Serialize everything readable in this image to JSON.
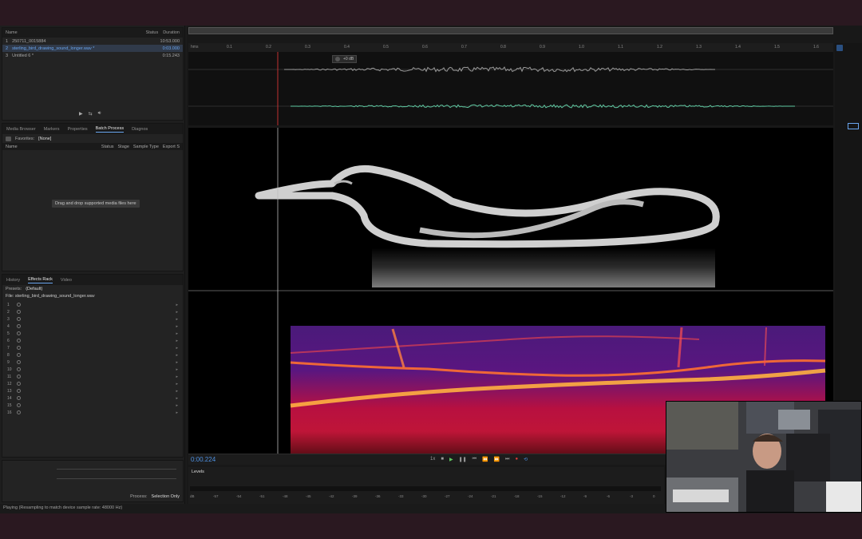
{
  "files_panel": {
    "columns": {
      "name": "Name",
      "status": "Status",
      "duration": "Duration"
    },
    "files": [
      {
        "num": "1",
        "name": "250711_0015884",
        "duration": "10:53.000"
      },
      {
        "num": "2",
        "name": "sterling_bird_drawing_sound_longer.wav *",
        "duration": "0:03.000"
      },
      {
        "num": "3",
        "name": "Untitled 6 *",
        "duration": "0:15.243"
      }
    ]
  },
  "batch_panel": {
    "tabs": [
      "Media Browser",
      "Markers",
      "Properties",
      "Batch Process",
      "Diagnos"
    ],
    "favorites_label": "Favorites:",
    "favorites_value": "[None]",
    "columns": [
      "Name",
      "Status",
      "Stage",
      "Sample Type",
      "Export S"
    ],
    "drop_hint": "Drag and drop supported media files here"
  },
  "effects_panel": {
    "tabs": [
      "History",
      "Effects Rack",
      "Video"
    ],
    "presets_label": "Presets:",
    "presets_value": "(Default)",
    "file_label": "File: sterling_bird_drawing_sound_longer.wav",
    "slots": [
      "1",
      "2",
      "3",
      "4",
      "5",
      "6",
      "7",
      "8",
      "9",
      "10",
      "11",
      "12",
      "13",
      "14",
      "15",
      "16"
    ],
    "process_label": "Process:",
    "process_value": "Selection Only"
  },
  "timeline": {
    "ruler_label": "hms",
    "ticks": [
      "0.1",
      "0.2",
      "0.3",
      "0.4",
      "0.5",
      "0.6",
      "0.7",
      "0.8",
      "0.9",
      "1.0",
      "1.1",
      "1.2",
      "1.3",
      "1.4",
      "1.5",
      "1.6"
    ],
    "hud_gain": "+0 dB",
    "time_display": "0:00.224",
    "speed": "1x",
    "levels_label": "Levels",
    "level_ticks": [
      "dB",
      "-57",
      "-54",
      "-51",
      "-48",
      "-45",
      "-42",
      "-39",
      "-36",
      "-33",
      "-30",
      "-27",
      "-24",
      "-21",
      "-18",
      "-15",
      "-12",
      "-9",
      "-6",
      "-3",
      "0"
    ]
  },
  "status_bar": {
    "text": "Playing (Resampling to match device sample rate: 48000 Hz)"
  },
  "colors": {
    "accent": "#4d8fe0",
    "waveform_green": "#5ec7a0",
    "playhead": "#c03030"
  }
}
